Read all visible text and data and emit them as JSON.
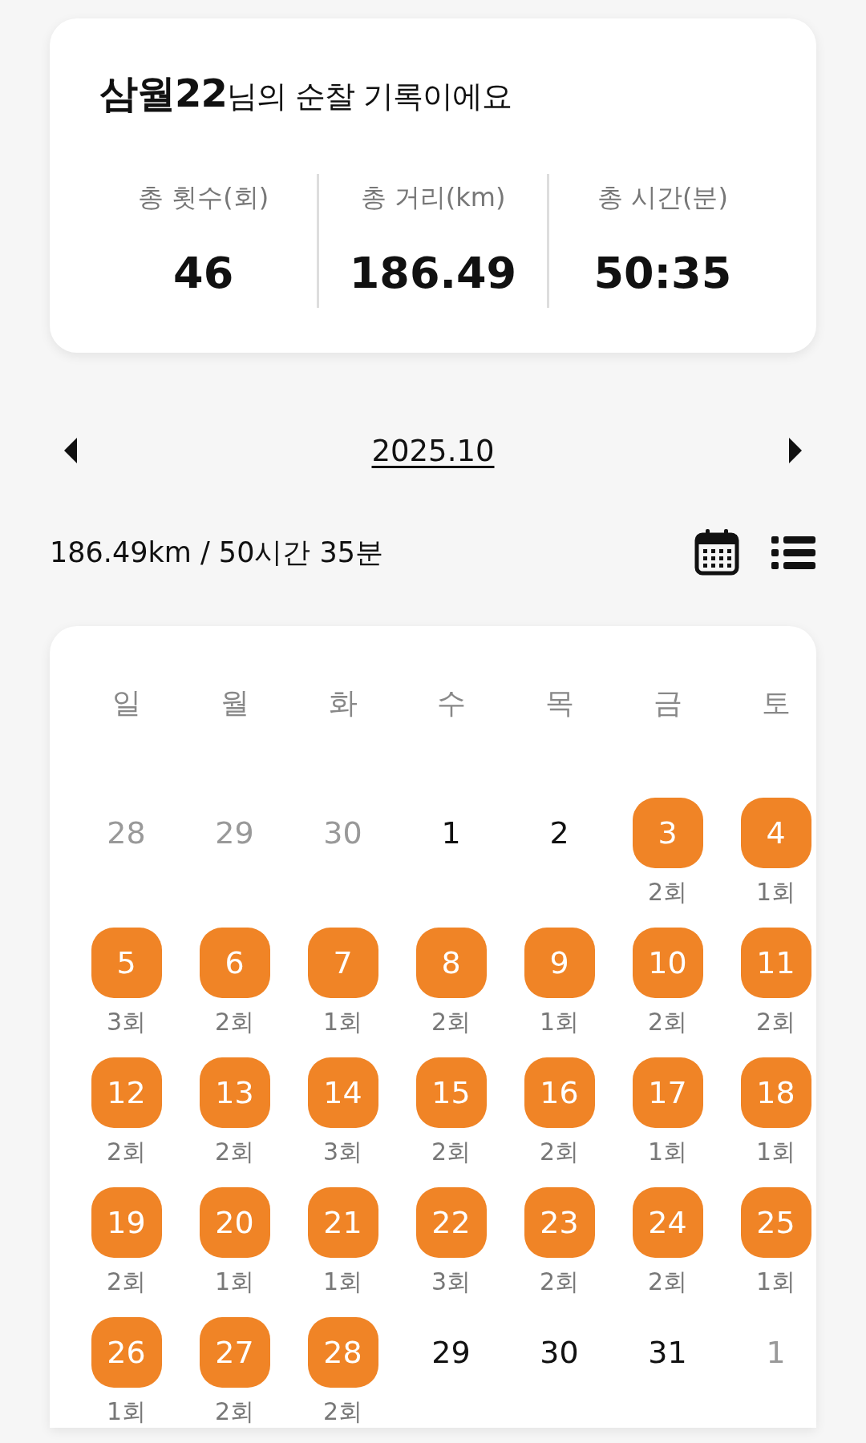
{
  "summary_card": {
    "title": "**삼월22**님의 순찰 기록이에요",
    "stats": [
      {
        "label": "총 횟수(회)",
        "value": "46"
      },
      {
        "label": "총 거리(km)",
        "value": "186.49"
      },
      {
        "label": "총 시간(분)",
        "value": "50:35"
      }
    ]
  },
  "month_nav": {
    "month": "2025.10"
  },
  "month_summary": "186.49km / 50시간 35분",
  "view_toggle": [
    {
      "kind": "calendar"
    },
    {
      "kind": "list"
    }
  ],
  "calendar": {
    "weekdays": [
      "일",
      "월",
      "화",
      "수",
      "목",
      "금",
      "토"
    ],
    "days": [
      {
        "day": "28",
        "in_month": false,
        "patrolled": false
      },
      {
        "day": "29",
        "in_month": false,
        "patrolled": false
      },
      {
        "day": "30",
        "in_month": false,
        "patrolled": false
      },
      {
        "day": "1",
        "in_month": true,
        "patrolled": false
      },
      {
        "day": "2",
        "in_month": true,
        "patrolled": false
      },
      {
        "day": "3",
        "in_month": true,
        "patrolled": true,
        "count": "2회"
      },
      {
        "day": "4",
        "in_month": true,
        "patrolled": true,
        "count": "1회"
      },
      {
        "day": "5",
        "in_month": true,
        "patrolled": true,
        "count": "3회"
      },
      {
        "day": "6",
        "in_month": true,
        "patrolled": true,
        "count": "2회"
      },
      {
        "day": "7",
        "in_month": true,
        "patrolled": true,
        "count": "1회"
      },
      {
        "day": "8",
        "in_month": true,
        "patrolled": true,
        "count": "2회"
      },
      {
        "day": "9",
        "in_month": true,
        "patrolled": true,
        "count": "1회"
      },
      {
        "day": "10",
        "in_month": true,
        "patrolled": true,
        "count": "2회"
      },
      {
        "day": "11",
        "in_month": true,
        "patrolled": true,
        "count": "2회"
      },
      {
        "day": "12",
        "in_month": true,
        "patrolled": true,
        "count": "2회"
      },
      {
        "day": "13",
        "in_month": true,
        "patrolled": true,
        "count": "2회"
      },
      {
        "day": "14",
        "in_month": true,
        "patrolled": true,
        "count": "3회"
      },
      {
        "day": "15",
        "in_month": true,
        "patrolled": true,
        "count": "2회"
      },
      {
        "day": "16",
        "in_month": true,
        "patrolled": true,
        "count": "2회"
      },
      {
        "day": "17",
        "in_month": true,
        "patrolled": true,
        "count": "1회"
      },
      {
        "day": "18",
        "in_month": true,
        "patrolled": true,
        "count": "1회"
      },
      {
        "day": "19",
        "in_month": true,
        "patrolled": true,
        "count": "2회"
      },
      {
        "day": "20",
        "in_month": true,
        "patrolled": true,
        "count": "1회"
      },
      {
        "day": "21",
        "in_month": true,
        "patrolled": true,
        "count": "1회"
      },
      {
        "day": "22",
        "in_month": true,
        "patrolled": true,
        "count": "3회"
      },
      {
        "day": "23",
        "in_month": true,
        "patrolled": true,
        "count": "2회"
      },
      {
        "day": "24",
        "in_month": true,
        "patrolled": true,
        "count": "2회"
      },
      {
        "day": "25",
        "in_month": true,
        "patrolled": true,
        "count": "1회"
      },
      {
        "day": "26",
        "in_month": true,
        "patrolled": true,
        "count": "1회"
      },
      {
        "day": "27",
        "in_month": true,
        "patrolled": true,
        "count": "2회"
      },
      {
        "day": "28",
        "in_month": true,
        "patrolled": true,
        "count": "2회"
      },
      {
        "day": "29",
        "in_month": true,
        "patrolled": false
      },
      {
        "day": "30",
        "in_month": true,
        "patrolled": false
      },
      {
        "day": "31",
        "in_month": true,
        "patrolled": false
      },
      {
        "day": "1",
        "in_month": false,
        "patrolled": false
      }
    ]
  }
}
